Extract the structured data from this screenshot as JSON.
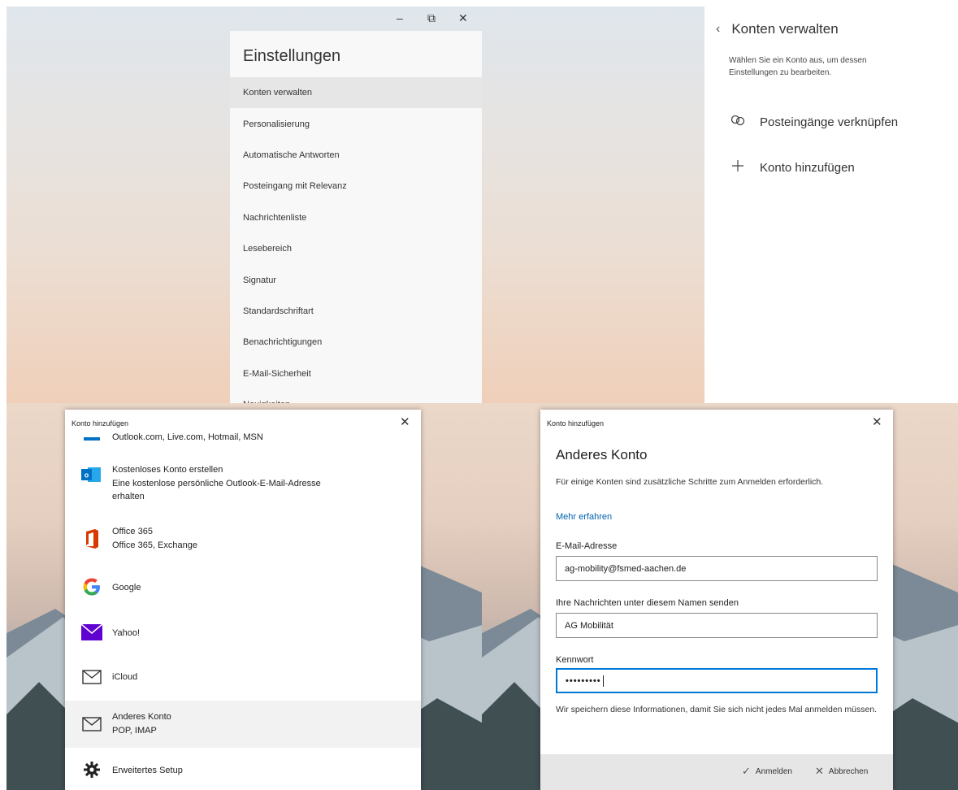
{
  "settings_window": {
    "controls": {
      "minimize": "–",
      "maximize": "⧉",
      "close": "✕"
    },
    "title": "Einstellungen",
    "items": [
      "Konten verwalten",
      "Personalisierung",
      "Automatische Antworten",
      "Posteingang mit Relevanz",
      "Nachrichtenliste",
      "Lesebereich",
      "Signatur",
      "Standardschriftart",
      "Benachrichtigungen",
      "E-Mail-Sicherheit",
      "Neuigkeiten"
    ],
    "selected_index": 0
  },
  "manage_accounts": {
    "back_icon": "chevron-left-icon",
    "title": "Konten verwalten",
    "description": "Wählen Sie ein Konto aus, um dessen Einstellungen zu bearbeiten.",
    "link_inboxes": {
      "icon": "link-icon",
      "label": "Posteingänge verknüpfen"
    },
    "add_account": {
      "icon": "plus-icon",
      "label": "Konto hinzufügen"
    }
  },
  "add_account_dialog": {
    "title": "Konto hinzufügen",
    "close": "✕",
    "providers": [
      {
        "icon": "outlook-bar-icon",
        "line1": "Outlook.com, Live.com, Hotmail, MSN",
        "line2": "",
        "line3": ""
      },
      {
        "icon": "outlook-icon",
        "line1": "Kostenloses Konto erstellen",
        "line2": "Eine kostenlose persönliche Outlook-E-Mail-Adresse",
        "line3": "erhalten"
      },
      {
        "icon": "office365-icon",
        "line1": "Office 365",
        "line2": "Office 365, Exchange",
        "line3": ""
      },
      {
        "icon": "google-icon",
        "line1": "Google",
        "line2": "",
        "line3": ""
      },
      {
        "icon": "yahoo-mail-icon",
        "line1": "Yahoo!",
        "line2": "",
        "line3": ""
      },
      {
        "icon": "envelope-icon",
        "line1": "iCloud",
        "line2": "",
        "line3": ""
      },
      {
        "icon": "envelope-icon",
        "line1": "Anderes Konto",
        "line2": "POP, IMAP",
        "line3": ""
      },
      {
        "icon": "gear-icon",
        "line1": "Erweitertes Setup",
        "line2": "",
        "line3": ""
      }
    ],
    "selected_index": 6
  },
  "other_account_dialog": {
    "title": "Konto hinzufügen",
    "close": "✕",
    "heading": "Anderes Konto",
    "intro": "Für einige Konten sind zusätzliche Schritte zum Anmelden erforderlich.",
    "learn_more": "Mehr erfahren",
    "email": {
      "label": "E-Mail-Adresse",
      "value": "ag-mobility@fsmed-aachen.de"
    },
    "name": {
      "label": "Ihre Nachrichten unter diesem Namen senden",
      "value": "AG Mobilität"
    },
    "password": {
      "label": "Kennwort",
      "value": "•••••••••"
    },
    "note": "Wir speichern diese Informationen, damit Sie sich nicht jedes Mal anmelden müssen.",
    "sign_in": {
      "icon": "checkmark-icon",
      "label": "Anmelden"
    },
    "cancel": {
      "icon": "close-icon",
      "label": "Abbrechen"
    }
  },
  "colors": {
    "accent": "#0078d7",
    "link": "#0063b1",
    "office_orange": "#d83b01",
    "outlook_blue": "#0072c6",
    "yahoo_purple": "#5f01d1"
  }
}
